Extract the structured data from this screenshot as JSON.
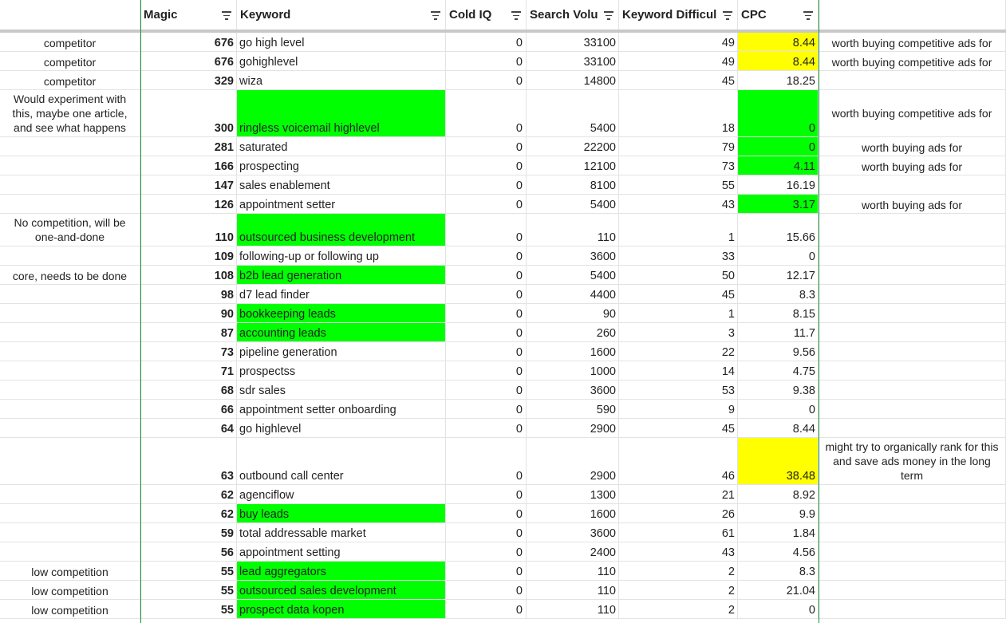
{
  "header": {
    "col_a": "",
    "magic": "Magic",
    "keyword": "Keyword",
    "cold_iq": "Cold IQ",
    "search_volume": "Search Volu",
    "keyword_difficulty": "Keyword Difficul",
    "cpc": "CPC",
    "col_h": ""
  },
  "colors": {
    "green_highlight": "#00ff00",
    "yellow_highlight": "#ffff00",
    "frame_line": "#1e8e3e"
  },
  "rows": [
    {
      "note": "competitor",
      "magic": "676",
      "keyword": "go high level",
      "cold": "0",
      "sv": "33100",
      "kd": "49",
      "cpc": "8.44",
      "comment": "worth buying competitive ads for",
      "h": 24,
      "kwc": "",
      "cpcc": "yellow"
    },
    {
      "note": "competitor",
      "magic": "676",
      "keyword": "gohighlevel",
      "cold": "0",
      "sv": "33100",
      "kd": "49",
      "cpc": "8.44",
      "comment": "worth buying competitive ads for",
      "h": 24,
      "kwc": "",
      "cpcc": "yellow"
    },
    {
      "note": "competitor",
      "magic": "329",
      "keyword": "wiza",
      "cold": "0",
      "sv": "14800",
      "kd": "45",
      "cpc": "18.25",
      "comment": "",
      "h": 24,
      "kwc": "",
      "cpcc": ""
    },
    {
      "note": "Would experiment with this, maybe one article, and see what happens",
      "magic": "300",
      "keyword": "ringless voicemail highlevel",
      "cold": "0",
      "sv": "5400",
      "kd": "18",
      "cpc": "0",
      "comment": "worth buying competitive ads for",
      "h": 59,
      "kwc": "green",
      "cpcc": "green"
    },
    {
      "note": "",
      "magic": "281",
      "keyword": "saturated",
      "cold": "0",
      "sv": "22200",
      "kd": "79",
      "cpc": "0",
      "comment": "worth buying ads for",
      "h": 24,
      "kwc": "",
      "cpcc": "green"
    },
    {
      "note": "",
      "magic": "166",
      "keyword": "prospecting",
      "cold": "0",
      "sv": "12100",
      "kd": "73",
      "cpc": "4.11",
      "comment": "worth buying ads for",
      "h": 24,
      "kwc": "",
      "cpcc": "green"
    },
    {
      "note": "",
      "magic": "147",
      "keyword": "sales enablement",
      "cold": "0",
      "sv": "8100",
      "kd": "55",
      "cpc": "16.19",
      "comment": "",
      "h": 24,
      "kwc": "",
      "cpcc": ""
    },
    {
      "note": "",
      "magic": "126",
      "keyword": "appointment setter",
      "cold": "0",
      "sv": "5400",
      "kd": "43",
      "cpc": "3.17",
      "comment": "worth buying ads for",
      "h": 24,
      "kwc": "",
      "cpcc": "green"
    },
    {
      "note": "No competition, will be one-and-done",
      "magic": "110",
      "keyword": "outsourced business development",
      "cold": "0",
      "sv": "110",
      "kd": "1",
      "cpc": "15.66",
      "comment": "",
      "h": 41,
      "kwc": "green",
      "cpcc": ""
    },
    {
      "note": "",
      "magic": "109",
      "keyword": "following-up or following up",
      "cold": "0",
      "sv": "3600",
      "kd": "33",
      "cpc": "0",
      "comment": "",
      "h": 24,
      "kwc": "",
      "cpcc": ""
    },
    {
      "note": "core, needs to be done",
      "magic": "108",
      "keyword": "b2b lead generation",
      "cold": "0",
      "sv": "5400",
      "kd": "50",
      "cpc": "12.17",
      "comment": "",
      "h": 24,
      "kwc": "green",
      "cpcc": ""
    },
    {
      "note": "",
      "magic": "98",
      "keyword": "d7 lead finder",
      "cold": "0",
      "sv": "4400",
      "kd": "45",
      "cpc": "8.3",
      "comment": "",
      "h": 24,
      "kwc": "",
      "cpcc": ""
    },
    {
      "note": "",
      "magic": "90",
      "keyword": "bookkeeping leads",
      "cold": "0",
      "sv": "90",
      "kd": "1",
      "cpc": "8.15",
      "comment": "",
      "h": 24,
      "kwc": "green",
      "cpcc": ""
    },
    {
      "note": "",
      "magic": "87",
      "keyword": "accounting leads",
      "cold": "0",
      "sv": "260",
      "kd": "3",
      "cpc": "11.7",
      "comment": "",
      "h": 24,
      "kwc": "green",
      "cpcc": ""
    },
    {
      "note": "",
      "magic": "73",
      "keyword": "pipeline generation",
      "cold": "0",
      "sv": "1600",
      "kd": "22",
      "cpc": "9.56",
      "comment": "",
      "h": 24,
      "kwc": "",
      "cpcc": ""
    },
    {
      "note": "",
      "magic": "71",
      "keyword": "prospectss",
      "cold": "0",
      "sv": "1000",
      "kd": "14",
      "cpc": "4.75",
      "comment": "",
      "h": 24,
      "kwc": "",
      "cpcc": ""
    },
    {
      "note": "",
      "magic": "68",
      "keyword": "sdr sales",
      "cold": "0",
      "sv": "3600",
      "kd": "53",
      "cpc": "9.38",
      "comment": "",
      "h": 24,
      "kwc": "",
      "cpcc": ""
    },
    {
      "note": "",
      "magic": "66",
      "keyword": "appointment setter onboarding",
      "cold": "0",
      "sv": "590",
      "kd": "9",
      "cpc": "0",
      "comment": "",
      "h": 24,
      "kwc": "",
      "cpcc": ""
    },
    {
      "note": "",
      "magic": "64",
      "keyword": "go highlevel",
      "cold": "0",
      "sv": "2900",
      "kd": "45",
      "cpc": "8.44",
      "comment": "",
      "h": 24,
      "kwc": "",
      "cpcc": ""
    },
    {
      "note": "",
      "magic": "63",
      "keyword": "outbound call center",
      "cold": "0",
      "sv": "2900",
      "kd": "46",
      "cpc": "38.48",
      "comment": "might try to organically rank for this and save ads money in the long term",
      "h": 59,
      "kwc": "",
      "cpcc": "yellow"
    },
    {
      "note": "",
      "magic": "62",
      "keyword": "agenciflow",
      "cold": "0",
      "sv": "1300",
      "kd": "21",
      "cpc": "8.92",
      "comment": "",
      "h": 24,
      "kwc": "",
      "cpcc": ""
    },
    {
      "note": "",
      "magic": "62",
      "keyword": "buy leads",
      "cold": "0",
      "sv": "1600",
      "kd": "26",
      "cpc": "9.9",
      "comment": "",
      "h": 24,
      "kwc": "green",
      "cpcc": ""
    },
    {
      "note": "",
      "magic": "59",
      "keyword": "total addressable market",
      "cold": "0",
      "sv": "3600",
      "kd": "61",
      "cpc": "1.84",
      "comment": "",
      "h": 24,
      "kwc": "",
      "cpcc": ""
    },
    {
      "note": "",
      "magic": "56",
      "keyword": "appointment setting",
      "cold": "0",
      "sv": "2400",
      "kd": "43",
      "cpc": "4.56",
      "comment": "",
      "h": 24,
      "kwc": "",
      "cpcc": ""
    },
    {
      "note": "low competition",
      "magic": "55",
      "keyword": "lead aggregators",
      "cold": "0",
      "sv": "110",
      "kd": "2",
      "cpc": "8.3",
      "comment": "",
      "h": 24,
      "kwc": "green",
      "cpcc": ""
    },
    {
      "note": "low competition",
      "magic": "55",
      "keyword": "outsourced sales development",
      "cold": "0",
      "sv": "110",
      "kd": "2",
      "cpc": "21.04",
      "comment": "",
      "h": 24,
      "kwc": "green",
      "cpcc": ""
    },
    {
      "note": "low competition",
      "magic": "55",
      "keyword": "prospect data kopen",
      "cold": "0",
      "sv": "110",
      "kd": "2",
      "cpc": "0",
      "comment": "",
      "h": 24,
      "kwc": "green",
      "cpcc": ""
    }
  ]
}
